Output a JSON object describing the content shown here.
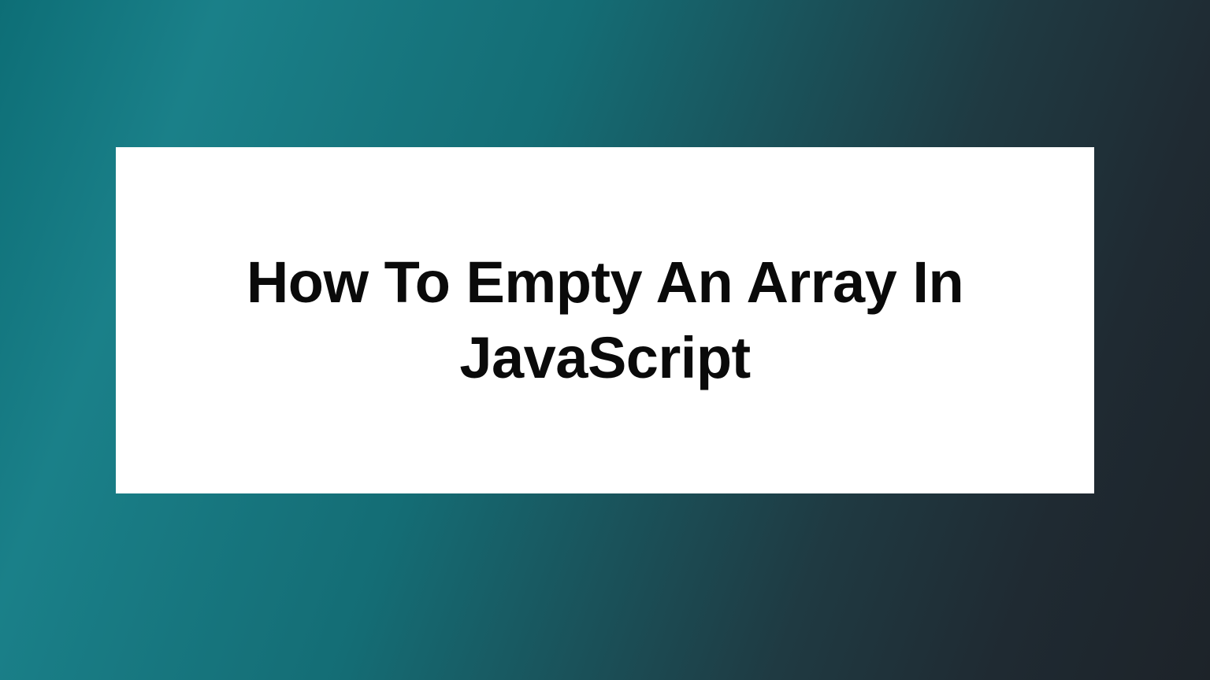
{
  "card": {
    "title": "How To Empty An Array In JavaScript"
  }
}
